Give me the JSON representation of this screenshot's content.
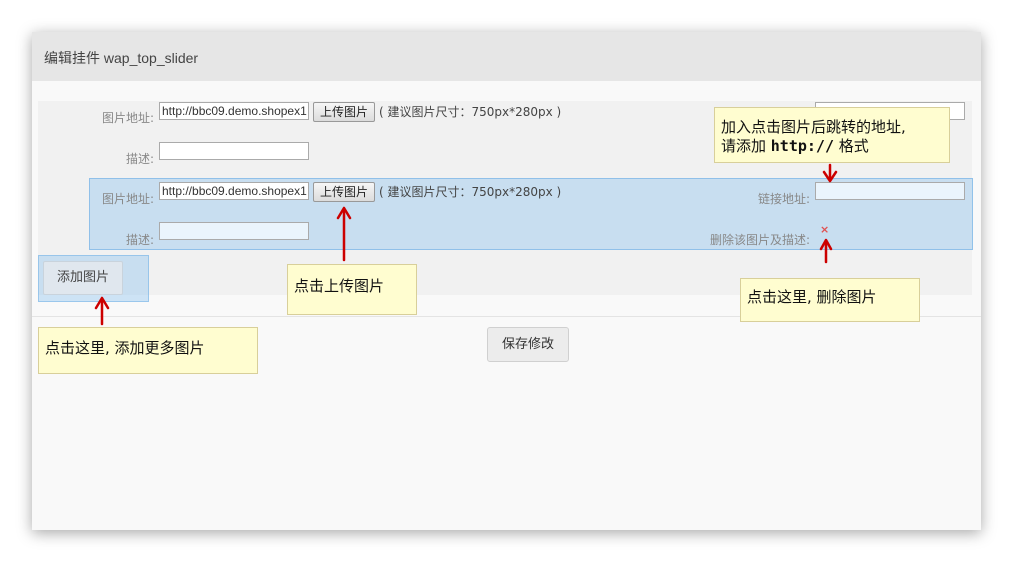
{
  "dialog": {
    "title": "编辑挂件 wap_top_slider"
  },
  "rows": [
    {
      "image_label": "图片地址:",
      "image_url": "http://bbc09.demo.shopex1",
      "upload_label": "上传图片",
      "size_hint": "( 建议图片尺寸：750px*280px )",
      "desc_label": "描述:",
      "desc_value": "",
      "link_label": "",
      "link_value": "",
      "delete_label": ""
    },
    {
      "image_label": "图片地址:",
      "image_url": "http://bbc09.demo.shopex1",
      "upload_label": "上传图片",
      "size_hint": "( 建议图片尺寸：750px*280px )",
      "desc_label": "描述:",
      "desc_value": "",
      "link_label": "链接地址:",
      "link_value": "",
      "delete_label": "删除该图片及描述:",
      "delete_icon": "×"
    }
  ],
  "buttons": {
    "add_image": "添加图片",
    "save": "保存修改"
  },
  "callouts": {
    "link_tip_line1": "加入点击图片后跳转的地址,",
    "link_tip_line2_pre": "请添加 ",
    "link_tip_code": "http://",
    "link_tip_line2_post": " 格式",
    "upload_tip": "点击上传图片",
    "delete_tip": "点击这里, 删除图片",
    "add_tip": "点击这里, 添加更多图片"
  },
  "colors": {
    "arrow": "#cc0000",
    "callout_bg": "#fffdd0",
    "highlight": "#bfdcf5"
  }
}
